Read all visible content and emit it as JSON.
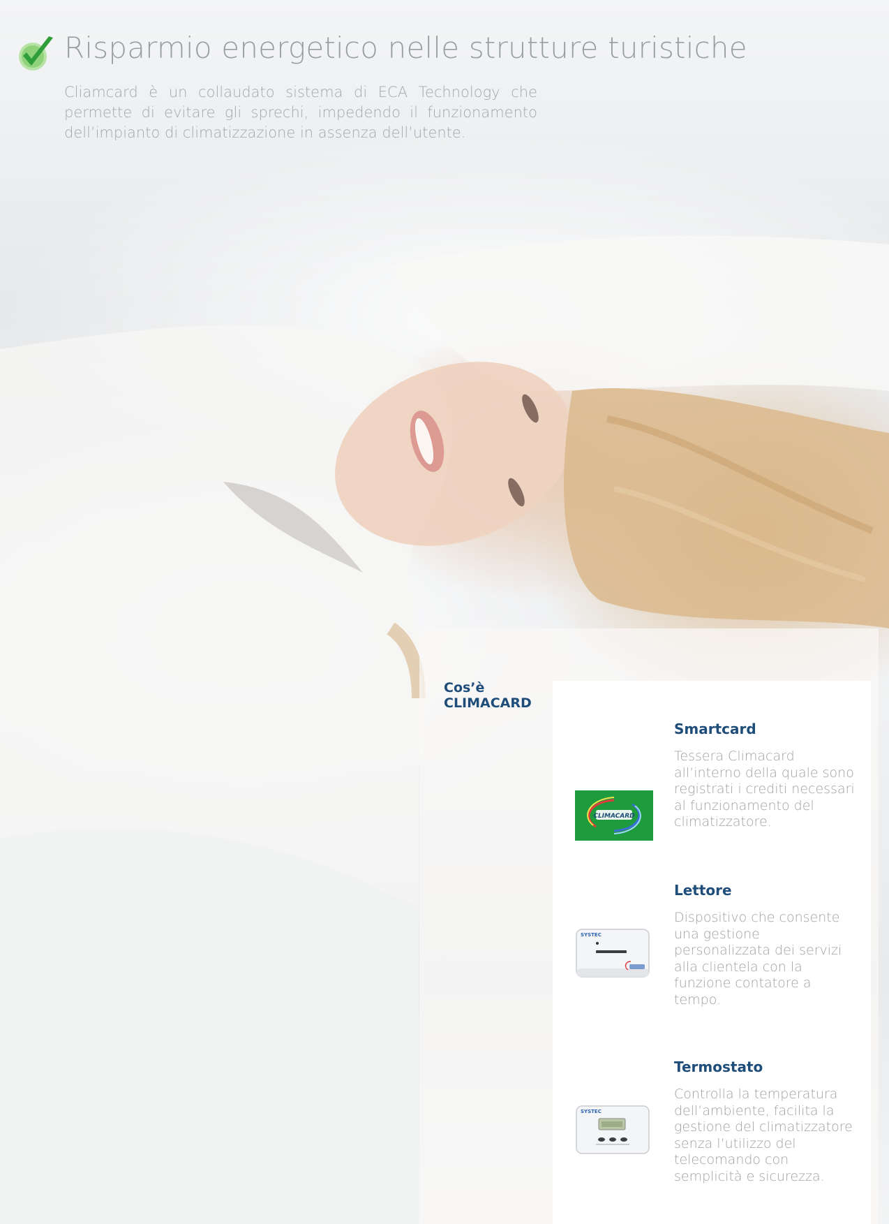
{
  "header": {
    "title": "Risparmio energetico nelle strutture turistiche",
    "intro": "Cliamcard è un collaudato sistema di ECA Technology che permette di evitare gli sprechi, impedendo il funzionamento dell’impianto di climatizzazione in assenza dell’utente."
  },
  "panel": {
    "label_line1": "Cos’è",
    "label_line2": "CLIMACARD"
  },
  "items": [
    {
      "title": "Smartcard",
      "text": "Tessera Climacard all’interno della quale sono registrati i crediti necessari al funzionamento del climatizzatore.",
      "image_icon": "climacard-smartcard-icon",
      "logo_text": "CLIMACARD"
    },
    {
      "title": "Lettore",
      "text": "Dispositivo che consente una gestione personalizzata dei servizi alla clientela con la funzione contatore a tempo.",
      "image_icon": "card-reader-icon",
      "brand_text": "SYSTEC"
    },
    {
      "title": "Termostato",
      "text": "Controlla la temperatura dell’ambiente, facilita la gestione del climatizzatore senza l’utilizzo del telecomando con semplicità e sicurezza.",
      "image_icon": "thermostat-icon",
      "brand_text": "SYSTEC"
    }
  ],
  "colors": {
    "heading_blue": "#1f4d7a",
    "check_green": "#3aa63a",
    "card_green": "#1e9b3c",
    "body_text": "#9da1a5"
  }
}
